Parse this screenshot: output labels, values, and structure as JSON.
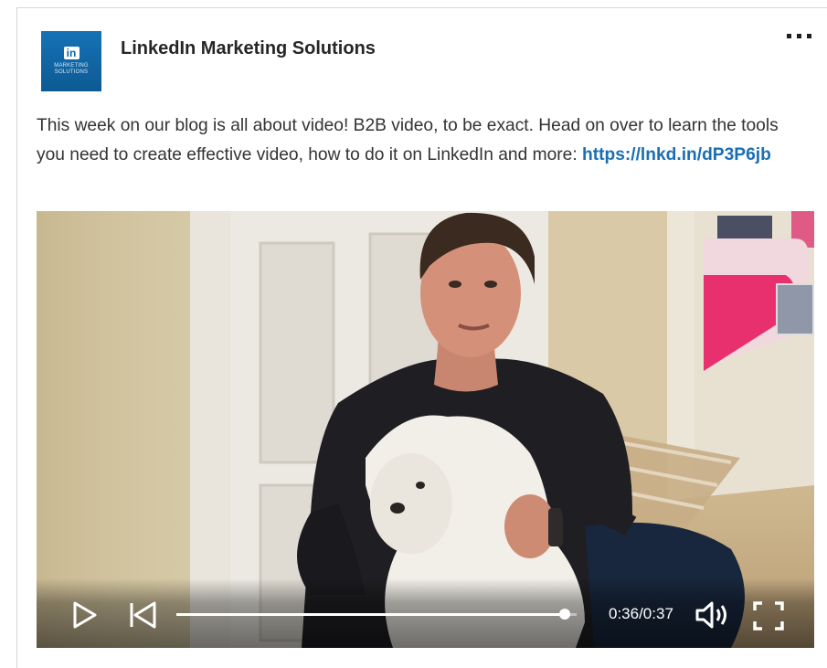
{
  "post": {
    "author": "LinkedIn Marketing Solutions",
    "logo": {
      "mark": "in",
      "line1": "MARKETING",
      "line2": "SOLUTIONS"
    },
    "more_icon": "ellipsis-icon",
    "text": "This week on our blog is all about video! B2B video, to be exact. Head on over to learn the tools you need to create effective video, how to do it on LinkedIn and more: ",
    "link": "https://lnkd.in/dP3P6jb"
  },
  "video": {
    "description": "man kneeling holding a small white dog in a hallway",
    "time_display": "0:36/0:37",
    "progress": 0.97,
    "controls": [
      "play-icon",
      "rewind-icon",
      "volume-icon",
      "fullscreen-icon"
    ]
  },
  "colors": {
    "link": "#1a6fb4",
    "brand": "#0e66a6"
  }
}
